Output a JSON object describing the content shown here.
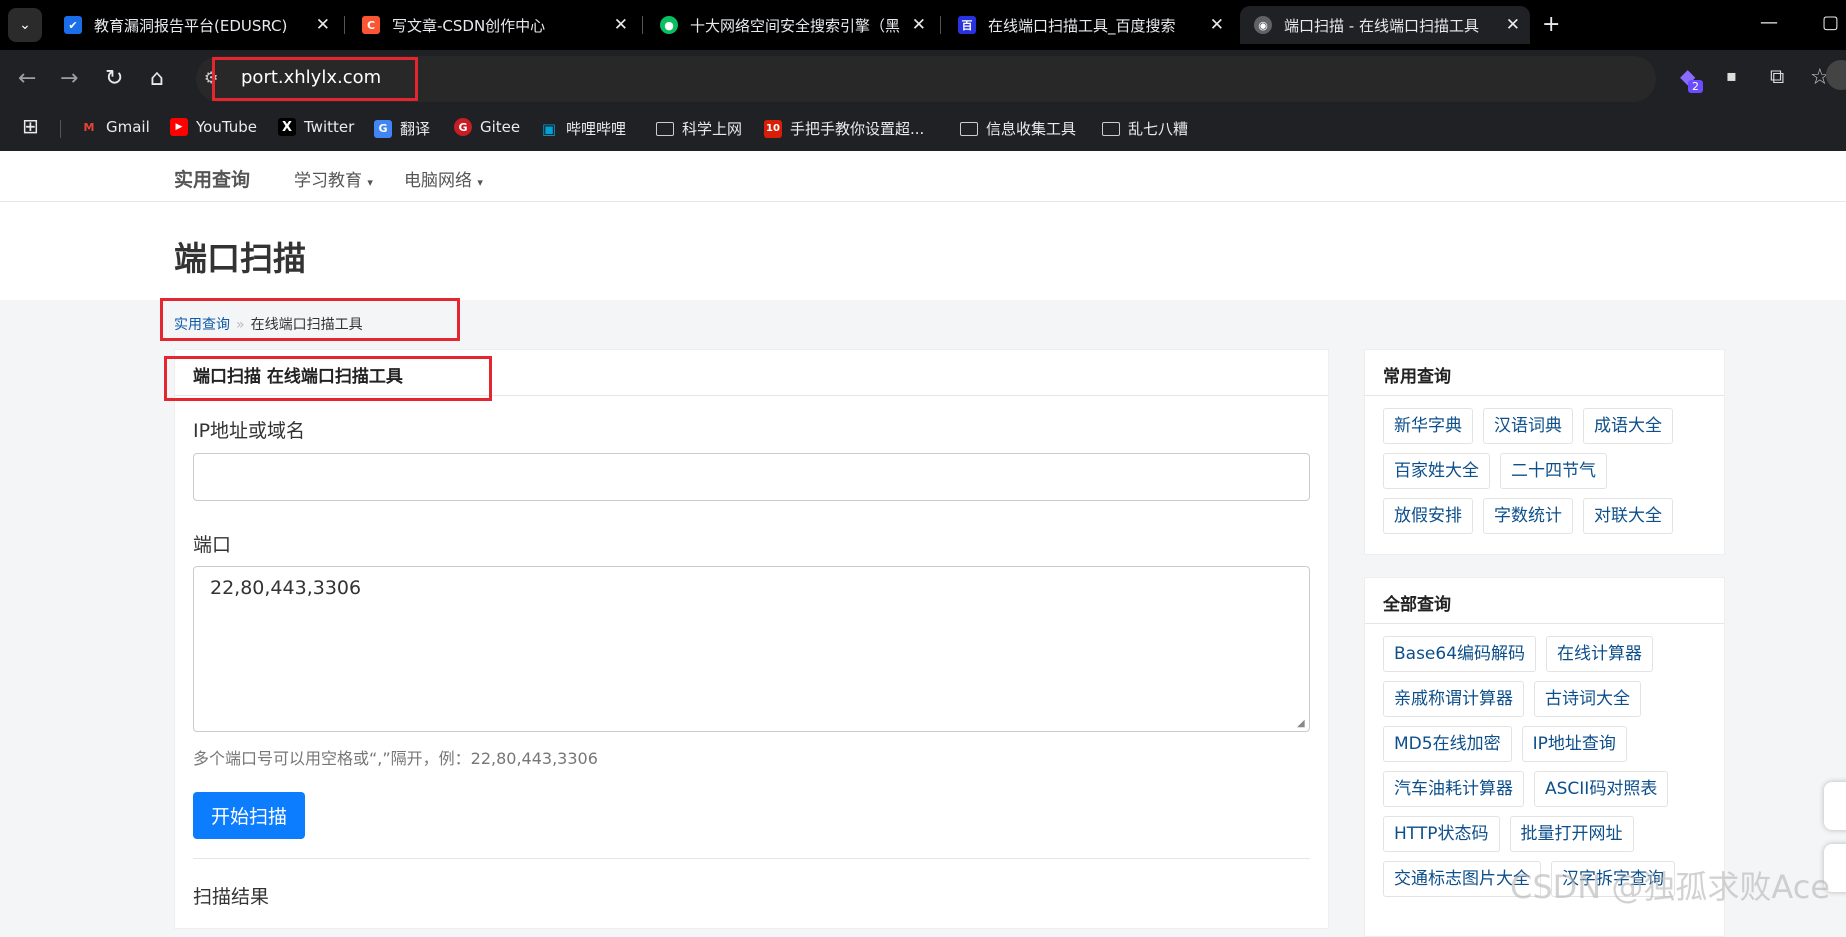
{
  "browser": {
    "tabs": [
      {
        "title": "教育漏洞报告平台(EDUSRC)",
        "color": "#1a6ee8",
        "glyph": "✔"
      },
      {
        "title": "写文章-CSDN创作中心",
        "color": "#fc5531",
        "glyph": "C"
      },
      {
        "title": "十大网络空间安全搜索引擎（黑",
        "color": "#07c160",
        "glyph": "●"
      },
      {
        "title": "在线端口扫描工具_百度搜索",
        "color": "#2932e1",
        "glyph": "百"
      },
      {
        "title": "端口扫描 - 在线端口扫描工具",
        "color": "#5f6368",
        "glyph": "◉"
      }
    ],
    "url": "port.xhlylx.com",
    "extension_badge": "2",
    "bookmarks": [
      {
        "label": "Gmail",
        "color": "#ea4335",
        "glyph": "M"
      },
      {
        "label": "YouTube",
        "color": "#ff0000",
        "glyph": "▶"
      },
      {
        "label": "Twitter",
        "color": "#000000",
        "glyph": "X"
      },
      {
        "label": "翻译",
        "color": "#4285f4",
        "glyph": "G"
      },
      {
        "label": "Gitee",
        "color": "#c71d23",
        "glyph": "G"
      },
      {
        "label": "哔哩哔哩",
        "color": "#00a1d6",
        "glyph": "▣"
      },
      {
        "label": "科学上网",
        "color": "",
        "glyph": "folder"
      },
      {
        "label": "手把手教你设置超...",
        "color": "#d81e06",
        "glyph": "10"
      },
      {
        "label": "信息收集工具",
        "color": "",
        "glyph": "folder"
      },
      {
        "label": "乱七八糟",
        "color": "",
        "glyph": "folder"
      }
    ]
  },
  "site": {
    "brand": "实用查询",
    "nav": [
      "学习教育",
      "电脑网络"
    ],
    "page_title": "端口扫描",
    "breadcrumb": {
      "home": "实用查询",
      "current": "在线端口扫描工具"
    }
  },
  "form": {
    "panel_title": "端口扫描 在线端口扫描工具",
    "ip_label": "IP地址或域名",
    "ip_value": "",
    "port_label": "端口",
    "port_value": "22,80,443,3306",
    "help": "多个端口号可以用空格或“,”隔开，例：22,80,443,3306",
    "submit": "开始扫描",
    "result_label": "扫描结果"
  },
  "sidebar": {
    "common": {
      "title": "常用查询",
      "items": [
        "新华字典",
        "汉语词典",
        "成语大全",
        "百家姓大全",
        "二十四节气",
        "放假安排",
        "字数统计",
        "对联大全"
      ]
    },
    "all": {
      "title": "全部查询",
      "items": [
        "Base64编码解码",
        "在线计算器",
        "亲戚称谓计算器",
        "古诗词大全",
        "MD5在线加密",
        "IP地址查询",
        "汽车油耗计算器",
        "ASCII码对照表",
        "HTTP状态码",
        "批量打开网址",
        "交通标志图片大全",
        "汉字拆字查询"
      ]
    }
  },
  "watermark": "CSDN @独孤求败Ace"
}
